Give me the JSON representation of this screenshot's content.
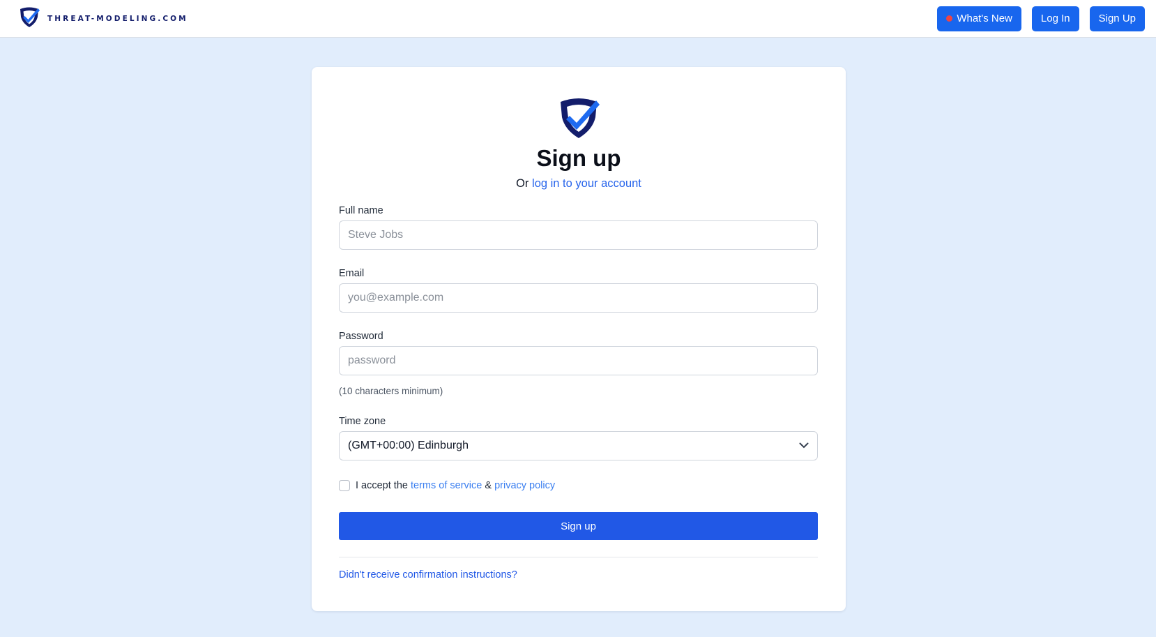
{
  "header": {
    "brand_name": "THREAT-MODELING.COM",
    "nav": {
      "whats_new_label": "What's New",
      "login_label": "Log In",
      "signup_label": "Sign Up"
    }
  },
  "form": {
    "title": "Sign up",
    "subtitle_prefix": "Or",
    "subtitle_link": "log in to your account",
    "full_name": {
      "label": "Full name",
      "placeholder": "Steve Jobs",
      "value": ""
    },
    "email": {
      "label": "Email",
      "placeholder": "you@example.com",
      "value": ""
    },
    "password": {
      "label": "Password",
      "placeholder": "password",
      "value": "",
      "hint": "(10 characters minimum)"
    },
    "time_zone": {
      "label": "Time zone",
      "selected": "(GMT+00:00) Edinburgh"
    },
    "terms": {
      "checked": false,
      "prefix": "I accept the",
      "terms_link": "terms of service",
      "joiner": "&",
      "privacy_link": "privacy policy"
    },
    "submit_label": "Sign up",
    "resend_link": "Didn't receive confirmation instructions?"
  },
  "colors": {
    "primary": "#1866ee",
    "button": "#2158e6",
    "link": "#2563eb",
    "brand_dark": "#131d6b",
    "notification_dot": "#ef4444",
    "page_background": "#e1edfc"
  },
  "icons": {
    "brand_logo": "shield-check-icon",
    "notification": "red-dot-icon",
    "select_arrow": "chevron-down-icon"
  }
}
